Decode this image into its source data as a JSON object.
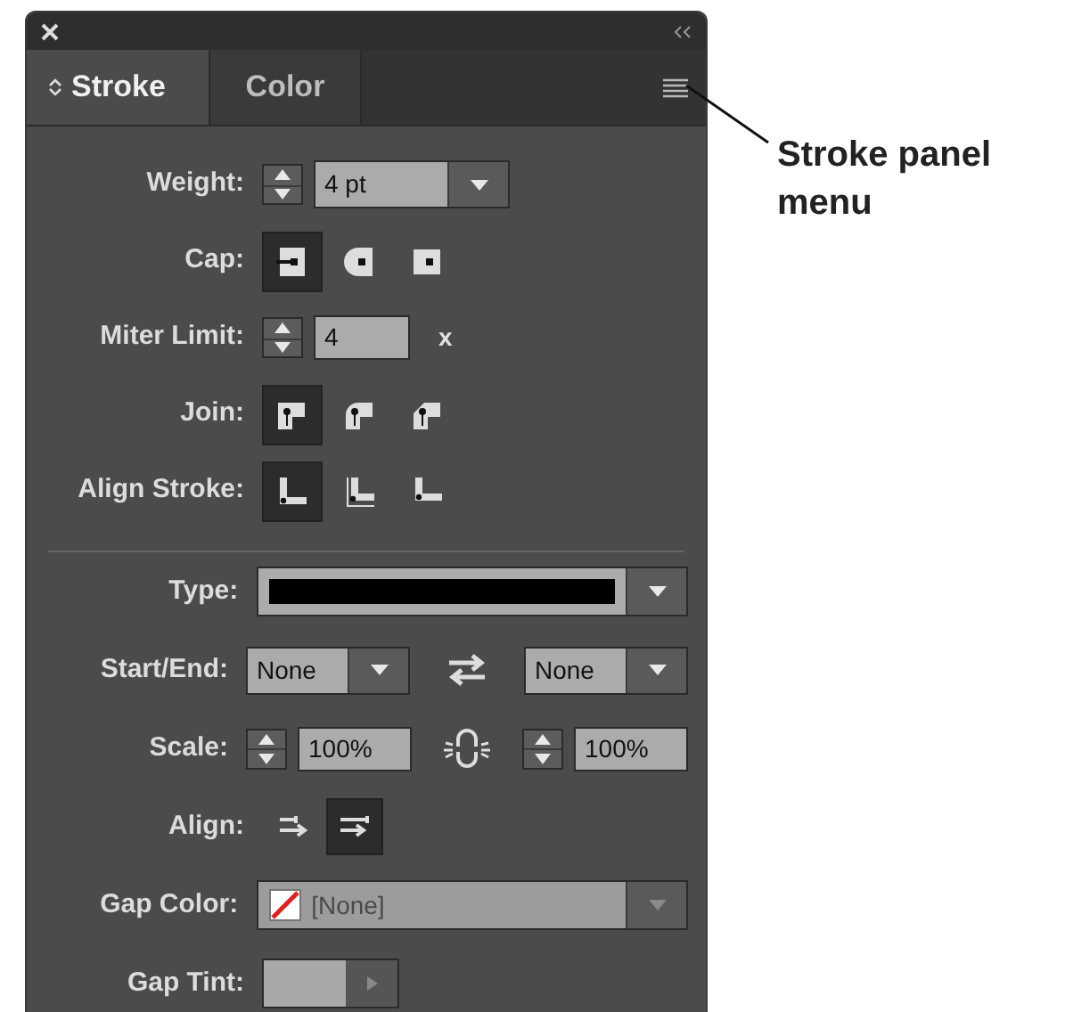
{
  "panel": {
    "tabs": [
      {
        "label": "Stroke",
        "selected": true
      },
      {
        "label": "Color",
        "selected": false
      }
    ]
  },
  "sections": [
    {
      "rows": [
        {
          "kind": "weight",
          "label": "Weight:",
          "value": "4 pt"
        },
        {
          "kind": "cap",
          "label": "Cap:",
          "options": [
            {
              "selected": true
            },
            {
              "selected": false
            },
            {
              "selected": false
            }
          ]
        },
        {
          "kind": "miter",
          "label": "Miter Limit:",
          "value": "4",
          "unit": "x"
        },
        {
          "kind": "join",
          "label": "Join:",
          "options": [
            {
              "selected": true
            },
            {
              "selected": false
            },
            {
              "selected": false
            }
          ]
        },
        {
          "kind": "stroke_align",
          "label": "Align Stroke:",
          "options": [
            {
              "selected": true
            },
            {
              "selected": false
            },
            {
              "selected": false
            }
          ]
        }
      ]
    },
    {
      "rows": [
        {
          "kind": "type",
          "label": "Type:"
        },
        {
          "kind": "start_end",
          "label": "Start/End:",
          "start": "None",
          "end": "None"
        },
        {
          "kind": "scale",
          "label": "Scale:",
          "start": "100%",
          "end": "100%"
        },
        {
          "kind": "arrow_align",
          "label": "Align:",
          "options": [
            {
              "selected": false
            },
            {
              "selected": true
            }
          ]
        },
        {
          "kind": "gap_color",
          "label": "Gap Color:",
          "value": "[None]"
        },
        {
          "kind": "gap_tint",
          "label": "Gap Tint:"
        }
      ]
    }
  ],
  "callout": {
    "text": "Stroke panel menu"
  }
}
